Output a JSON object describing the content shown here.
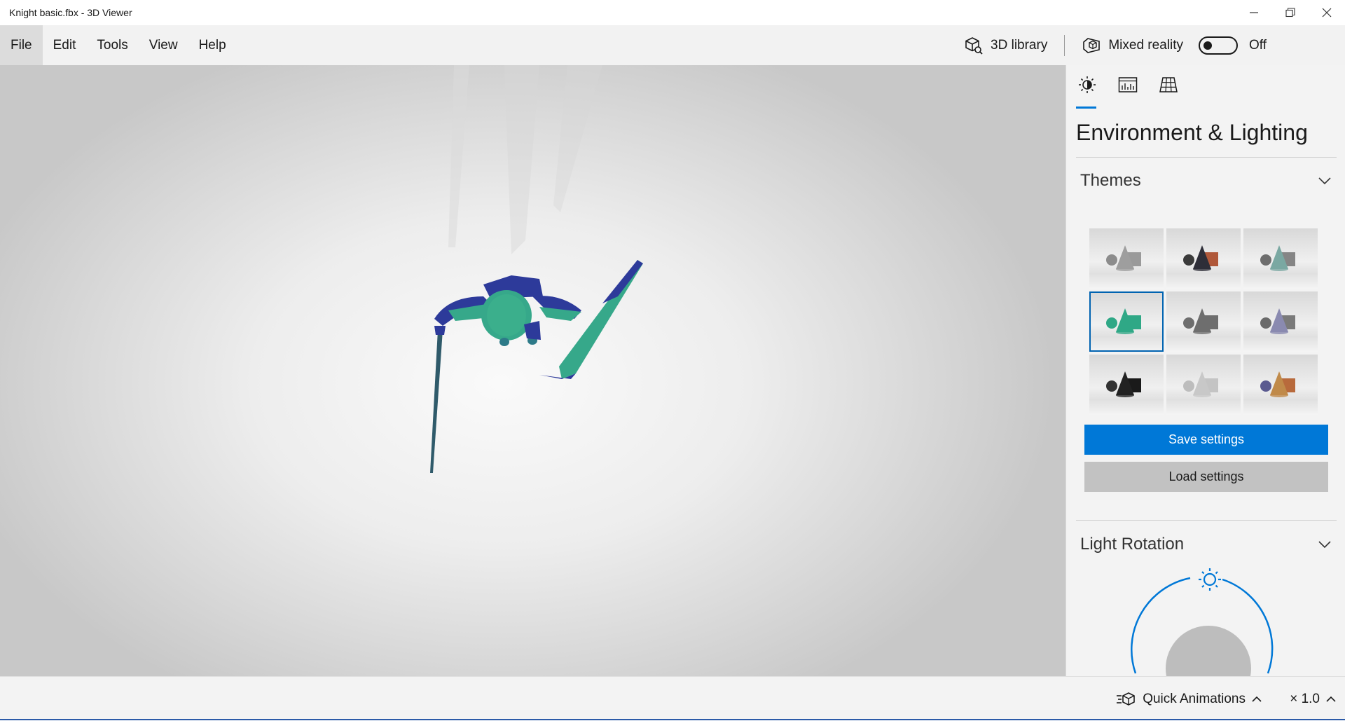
{
  "window": {
    "title": "Knight basic.fbx - 3D Viewer"
  },
  "menu": {
    "items": [
      "File",
      "Edit",
      "Tools",
      "View",
      "Help"
    ],
    "library_label": "3D library",
    "mixed_reality_label": "Mixed reality",
    "mixed_reality_state": "Off"
  },
  "panel": {
    "title": "Environment & Lighting",
    "themes_header": "Themes",
    "save_label": "Save settings",
    "load_label": "Load settings",
    "light_rotation_header": "Light Rotation",
    "selected_theme_index": 3,
    "themes": [
      {
        "cone": "#9e9e9e",
        "box": "#9a9a9a",
        "sphere": "#8c8c8c"
      },
      {
        "cone": "#2e2e38",
        "box": "#b0583a",
        "sphere": "#3b3b3b"
      },
      {
        "cone": "#7aa8a2",
        "box": "#858585",
        "sphere": "#6d6d6d"
      },
      {
        "cone": "#2fa886",
        "box": "#2fa886",
        "sphere": "#2fa886"
      },
      {
        "cone": "#6e6e6e",
        "box": "#6e6e6e",
        "sphere": "#6e6e6e"
      },
      {
        "cone": "#8a8ab0",
        "box": "#7a7a7a",
        "sphere": "#6a6a6a"
      },
      {
        "cone": "#222222",
        "box": "#1a1a1a",
        "sphere": "#333333"
      },
      {
        "cone": "#c8c8c8",
        "box": "#c4c4c4",
        "sphere": "#bdbdbd"
      },
      {
        "cone": "#c08a4a",
        "box": "#b86a3c",
        "sphere": "#5a5a90"
      }
    ]
  },
  "bottom": {
    "quick_animations_label": "Quick Animations",
    "speed_label": "× 1.0"
  },
  "colors": {
    "accent": "#0078d7",
    "model_green": "#36a88a",
    "model_blue": "#2d3a9a"
  }
}
